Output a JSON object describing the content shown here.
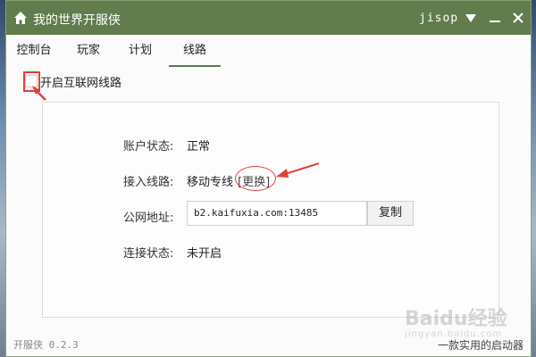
{
  "window": {
    "title": "我的世界开服侠",
    "user": "jisop"
  },
  "tabs": [
    {
      "label": "控制台",
      "active": false
    },
    {
      "label": "玩家",
      "active": false
    },
    {
      "label": "计划",
      "active": false
    },
    {
      "label": "线路",
      "active": true
    }
  ],
  "options": {
    "internet_line_label": "开启互联网线路",
    "internet_line_checked": false
  },
  "panel": {
    "account_status_label": "账户状态:",
    "account_status_value": "正常",
    "access_line_label": "接入线路:",
    "access_line_value": "移动专线",
    "change_label": "[更换]",
    "public_addr_label": "公网地址:",
    "public_addr_value": "b2.kaifuxia.com:13485",
    "copy_label": "复制",
    "connection_status_label": "连接状态:",
    "connection_status_value": "未开启"
  },
  "footer": {
    "version": "开服侠 0.2.3",
    "slogan": "一款实用的启动器"
  },
  "watermark": {
    "text": "Baidu经验",
    "sub": "jingyan.baidu.com"
  },
  "colors": {
    "titlebar": "#617c4d",
    "annotation": "#e2403a",
    "active_tab": "#5f7a4b"
  }
}
